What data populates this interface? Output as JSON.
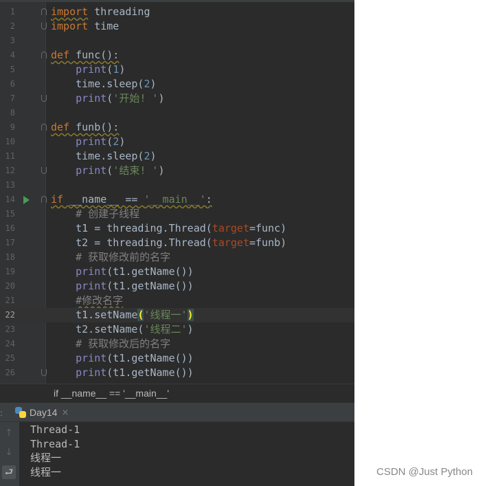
{
  "editor": {
    "current_line": 22,
    "lines": [
      {
        "n": "1",
        "code": "import threading"
      },
      {
        "n": "2",
        "code": "import time"
      },
      {
        "n": "3",
        "code": ""
      },
      {
        "n": "4",
        "code": "def func():"
      },
      {
        "n": "5",
        "code": "    print(1)"
      },
      {
        "n": "6",
        "code": "    time.sleep(2)"
      },
      {
        "n": "7",
        "code": "    print('开始! ')"
      },
      {
        "n": "8",
        "code": ""
      },
      {
        "n": "9",
        "code": "def funb():"
      },
      {
        "n": "10",
        "code": "    print(2)"
      },
      {
        "n": "11",
        "code": "    time.sleep(2)"
      },
      {
        "n": "12",
        "code": "    print('结束! ')"
      },
      {
        "n": "13",
        "code": ""
      },
      {
        "n": "14",
        "code": "if __name__ == '__main__':"
      },
      {
        "n": "15",
        "code": "    # 创建子线程"
      },
      {
        "n": "16",
        "code": "    t1 = threading.Thread(target=func)"
      },
      {
        "n": "17",
        "code": "    t2 = threading.Thread(target=funb)"
      },
      {
        "n": "18",
        "code": "    # 获取修改前的名字"
      },
      {
        "n": "19",
        "code": "    print(t1.getName())"
      },
      {
        "n": "20",
        "code": "    print(t1.getName())"
      },
      {
        "n": "21",
        "code": "    #修改名字"
      },
      {
        "n": "22",
        "code": "    t1.setName('线程一')"
      },
      {
        "n": "23",
        "code": "    t2.setName('线程二')"
      },
      {
        "n": "24",
        "code": "    # 获取修改后的名字"
      },
      {
        "n": "25",
        "code": "    print(t1.getName())"
      },
      {
        "n": "26",
        "code": "    print(t1.getName())"
      }
    ]
  },
  "breadcrumb": {
    "text": "if __name__ == '__main__'"
  },
  "run_panel": {
    "tab_label": "Day14",
    "tab_close": "×",
    "output": [
      "Thread-1",
      "Thread-1",
      "线程一",
      "线程一"
    ],
    "buttons": [
      {
        "name": "scroll-up-icon",
        "glyph": "↑"
      },
      {
        "name": "scroll-down-icon",
        "glyph": "↓"
      },
      {
        "name": "soft-wrap-icon",
        "glyph": "⮐"
      }
    ]
  },
  "watermark": "CSDN @Just Python",
  "colors": {
    "editor_bg": "#2b2b2b",
    "gutter_bg": "#313335",
    "keyword": "#cc7832",
    "builtin": "#8888c6",
    "number": "#6897bb",
    "string": "#6a8759",
    "comment": "#808080",
    "param": "#aa4926"
  }
}
